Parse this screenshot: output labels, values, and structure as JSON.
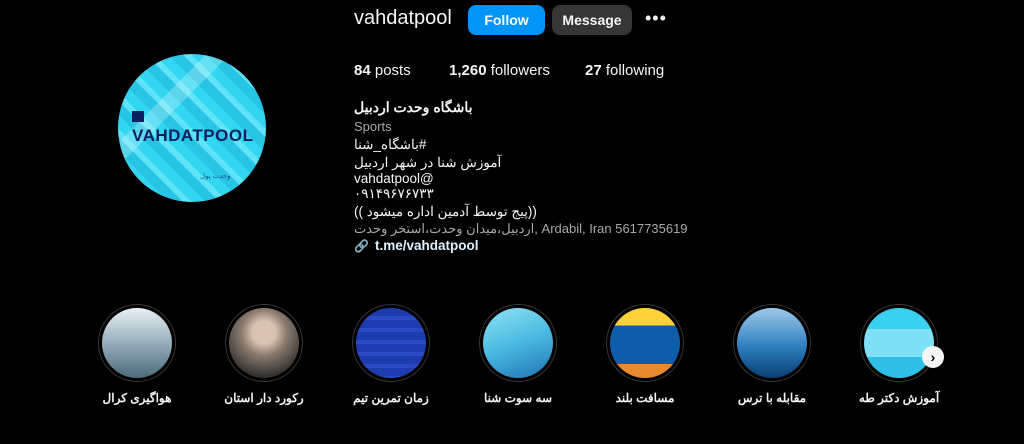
{
  "profile": {
    "username": "vahdatpool",
    "follow_label": "Follow",
    "message_label": "Message",
    "more_label": "•••",
    "avatar_text": "VAHDATPOOL",
    "stats": {
      "posts_count": "84",
      "posts_label": "posts",
      "followers_count": "1,260",
      "followers_label": "followers",
      "following_count": "27",
      "following_label": "following"
    },
    "bio": {
      "name": "باشگاه وحدت اردبیل",
      "category": "Sports",
      "line1": "#باشگاه_شنا",
      "line2": "آموزش شنا در شهر اردبیل",
      "line3": "vahdatpool@",
      "line4": "۰۹۱۴۹۶۷۶۷۳۳",
      "line5": "((پیج توسط آدمین اداره میشود ))",
      "address": "اردبیل،میدان وحدت،استخر وحدت, Ardabil, Iran 5617735619",
      "link": "t.me/vahdatpool"
    }
  },
  "highlights": [
    {
      "label": "هواگیری کرال"
    },
    {
      "label": "رکورد دار استان"
    },
    {
      "label": "زمان تمرین تیم"
    },
    {
      "label": "سه سوت شنا"
    },
    {
      "label": "مسافت بلند"
    },
    {
      "label": "مقابله با ترس"
    },
    {
      "label": "آموزش دکتر طه"
    }
  ],
  "highlights_next_label": "›"
}
